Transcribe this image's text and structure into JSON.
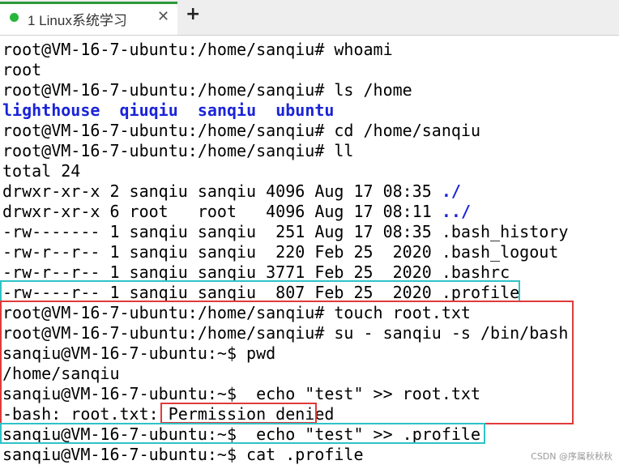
{
  "tab": {
    "label": "1 Linux系统学习",
    "close_glyph": "✕"
  },
  "new_tab_glyph": "+",
  "terminal": {
    "lines": [
      "root@VM-16-7-ubuntu:/home/sanqiu# whoami",
      "root",
      "root@VM-16-7-ubuntu:/home/sanqiu# ls /home",
      "",
      "root@VM-16-7-ubuntu:/home/sanqiu# cd /home/sanqiu",
      "root@VM-16-7-ubuntu:/home/sanqiu# ll",
      "total 24",
      "drwxr-xr-x 2 sanqiu sanqiu 4096 Aug 17 08:35 ",
      "drwxr-xr-x 6 root   root   4096 Aug 17 08:11 ",
      "-rw------- 1 sanqiu sanqiu  251 Aug 17 08:35 .bash_history",
      "-rw-r--r-- 1 sanqiu sanqiu  220 Feb 25  2020 .bash_logout",
      "-rw-r--r-- 1 sanqiu sanqiu 3771 Feb 25  2020 .bashrc",
      "-rw----r-- 1 sanqiu sanqiu  807 Feb 25  2020 .profile",
      "root@VM-16-7-ubuntu:/home/sanqiu# touch root.txt",
      "root@VM-16-7-ubuntu:/home/sanqiu# su - sanqiu -s /bin/bash",
      "sanqiu@VM-16-7-ubuntu:~$ pwd",
      "/home/sanqiu",
      "sanqiu@VM-16-7-ubuntu:~$  echo \"test\" >> root.txt",
      "-bash: root.txt: Permission denied",
      "sanqiu@VM-16-7-ubuntu:~$  echo \"test\" >> .profile",
      "sanqiu@VM-16-7-ubuntu:~$ cat .profile"
    ],
    "home_dirs": [
      "lighthouse",
      "qiuqiu",
      "sanqiu",
      "ubuntu"
    ],
    "dir_links": [
      "./",
      "../"
    ]
  },
  "colors": {
    "directory": "#1a24d8",
    "highlight_cyan": "#2fc2c7",
    "highlight_red": "#e03b3b",
    "tab_status_dot": "#27b53b"
  },
  "watermark": "CSDN @序属秋秋秋"
}
